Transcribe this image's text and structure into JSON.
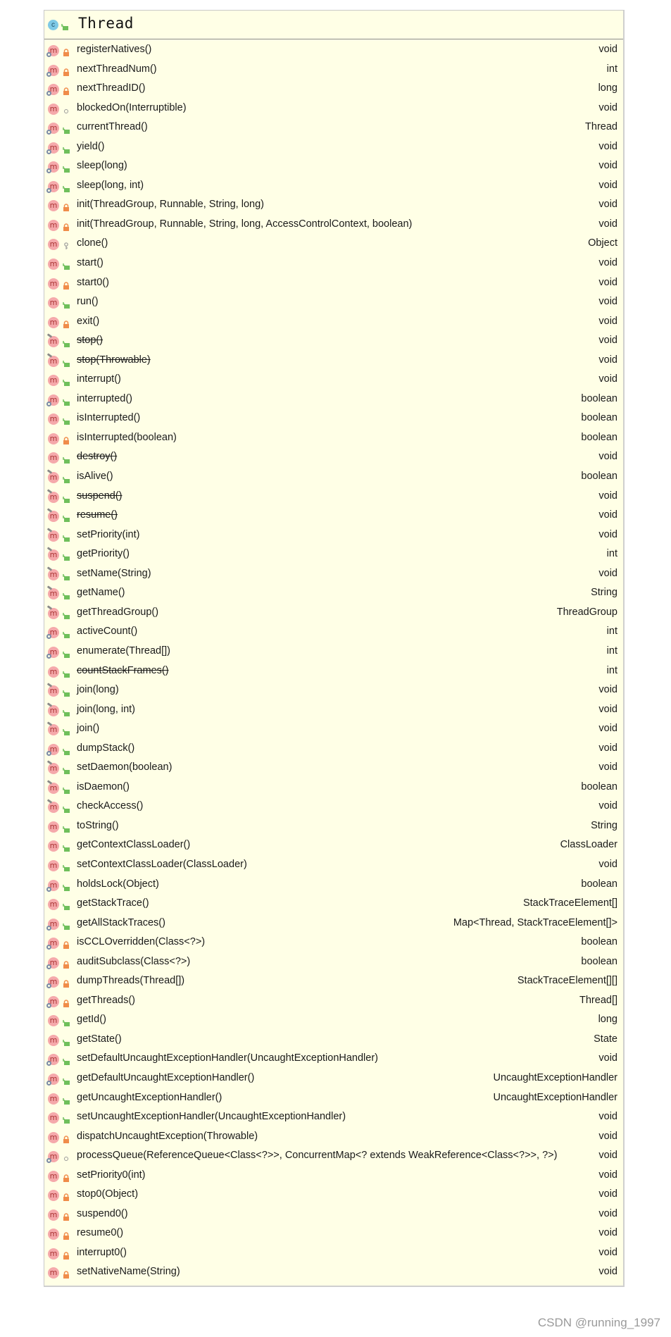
{
  "class": {
    "name": "Thread",
    "kind_icon": "class-icon",
    "visibility": "public"
  },
  "colors": {
    "background": "#ffffe6",
    "method_icon": "#f5a9ab",
    "class_icon": "#7ec9e6",
    "public": "#6fbf5b",
    "private": "#f08c4a"
  },
  "methods": [
    {
      "name": "registerNatives()",
      "type": "void",
      "vis": "private",
      "static": true,
      "final": false,
      "deprecated": false
    },
    {
      "name": "nextThreadNum()",
      "type": "int",
      "vis": "private",
      "static": true,
      "final": false,
      "deprecated": false
    },
    {
      "name": "nextThreadID()",
      "type": "long",
      "vis": "private",
      "static": true,
      "final": false,
      "deprecated": false
    },
    {
      "name": "blockedOn(Interruptible)",
      "type": "void",
      "vis": "package",
      "static": false,
      "final": false,
      "deprecated": false
    },
    {
      "name": "currentThread()",
      "type": "Thread",
      "vis": "public",
      "static": true,
      "final": false,
      "deprecated": false
    },
    {
      "name": "yield()",
      "type": "void",
      "vis": "public",
      "static": true,
      "final": false,
      "deprecated": false
    },
    {
      "name": "sleep(long)",
      "type": "void",
      "vis": "public",
      "static": true,
      "final": false,
      "deprecated": false
    },
    {
      "name": "sleep(long, int)",
      "type": "void",
      "vis": "public",
      "static": true,
      "final": false,
      "deprecated": false
    },
    {
      "name": "init(ThreadGroup, Runnable, String, long)",
      "type": "void",
      "vis": "private",
      "static": false,
      "final": false,
      "deprecated": false
    },
    {
      "name": "init(ThreadGroup, Runnable, String, long, AccessControlContext, boolean)",
      "type": "void",
      "vis": "private",
      "static": false,
      "final": false,
      "deprecated": false
    },
    {
      "name": "clone()",
      "type": "Object",
      "vis": "protected",
      "static": false,
      "final": false,
      "deprecated": false
    },
    {
      "name": "start()",
      "type": "void",
      "vis": "public",
      "static": false,
      "final": false,
      "deprecated": false
    },
    {
      "name": "start0()",
      "type": "void",
      "vis": "private",
      "static": false,
      "final": false,
      "deprecated": false
    },
    {
      "name": "run()",
      "type": "void",
      "vis": "public",
      "static": false,
      "final": false,
      "deprecated": false
    },
    {
      "name": "exit()",
      "type": "void",
      "vis": "private",
      "static": false,
      "final": false,
      "deprecated": false
    },
    {
      "name": "stop()",
      "type": "void",
      "vis": "public",
      "static": false,
      "final": true,
      "deprecated": true
    },
    {
      "name": "stop(Throwable)",
      "type": "void",
      "vis": "public",
      "static": false,
      "final": true,
      "deprecated": true
    },
    {
      "name": "interrupt()",
      "type": "void",
      "vis": "public",
      "static": false,
      "final": false,
      "deprecated": false
    },
    {
      "name": "interrupted()",
      "type": "boolean",
      "vis": "public",
      "static": true,
      "final": false,
      "deprecated": false
    },
    {
      "name": "isInterrupted()",
      "type": "boolean",
      "vis": "public",
      "static": false,
      "final": false,
      "deprecated": false
    },
    {
      "name": "isInterrupted(boolean)",
      "type": "boolean",
      "vis": "private",
      "static": false,
      "final": false,
      "deprecated": false
    },
    {
      "name": "destroy()",
      "type": "void",
      "vis": "public",
      "static": false,
      "final": false,
      "deprecated": true
    },
    {
      "name": "isAlive()",
      "type": "boolean",
      "vis": "public",
      "static": false,
      "final": true,
      "deprecated": false
    },
    {
      "name": "suspend()",
      "type": "void",
      "vis": "public",
      "static": false,
      "final": true,
      "deprecated": true
    },
    {
      "name": "resume()",
      "type": "void",
      "vis": "public",
      "static": false,
      "final": true,
      "deprecated": true
    },
    {
      "name": "setPriority(int)",
      "type": "void",
      "vis": "public",
      "static": false,
      "final": true,
      "deprecated": false
    },
    {
      "name": "getPriority()",
      "type": "int",
      "vis": "public",
      "static": false,
      "final": true,
      "deprecated": false
    },
    {
      "name": "setName(String)",
      "type": "void",
      "vis": "public",
      "static": false,
      "final": true,
      "deprecated": false
    },
    {
      "name": "getName()",
      "type": "String",
      "vis": "public",
      "static": false,
      "final": true,
      "deprecated": false
    },
    {
      "name": "getThreadGroup()",
      "type": "ThreadGroup",
      "vis": "public",
      "static": false,
      "final": true,
      "deprecated": false
    },
    {
      "name": "activeCount()",
      "type": "int",
      "vis": "public",
      "static": true,
      "final": false,
      "deprecated": false
    },
    {
      "name": "enumerate(Thread[])",
      "type": "int",
      "vis": "public",
      "static": true,
      "final": false,
      "deprecated": false
    },
    {
      "name": "countStackFrames()",
      "type": "int",
      "vis": "public",
      "static": false,
      "final": false,
      "deprecated": true
    },
    {
      "name": "join(long)",
      "type": "void",
      "vis": "public",
      "static": false,
      "final": true,
      "deprecated": false
    },
    {
      "name": "join(long, int)",
      "type": "void",
      "vis": "public",
      "static": false,
      "final": true,
      "deprecated": false
    },
    {
      "name": "join()",
      "type": "void",
      "vis": "public",
      "static": false,
      "final": true,
      "deprecated": false
    },
    {
      "name": "dumpStack()",
      "type": "void",
      "vis": "public",
      "static": true,
      "final": false,
      "deprecated": false
    },
    {
      "name": "setDaemon(boolean)",
      "type": "void",
      "vis": "public",
      "static": false,
      "final": true,
      "deprecated": false
    },
    {
      "name": "isDaemon()",
      "type": "boolean",
      "vis": "public",
      "static": false,
      "final": true,
      "deprecated": false
    },
    {
      "name": "checkAccess()",
      "type": "void",
      "vis": "public",
      "static": false,
      "final": true,
      "deprecated": false
    },
    {
      "name": "toString()",
      "type": "String",
      "vis": "public",
      "static": false,
      "final": false,
      "deprecated": false
    },
    {
      "name": "getContextClassLoader()",
      "type": "ClassLoader",
      "vis": "public",
      "static": false,
      "final": false,
      "deprecated": false
    },
    {
      "name": "setContextClassLoader(ClassLoader)",
      "type": "void",
      "vis": "public",
      "static": false,
      "final": false,
      "deprecated": false
    },
    {
      "name": "holdsLock(Object)",
      "type": "boolean",
      "vis": "public",
      "static": true,
      "final": false,
      "deprecated": false
    },
    {
      "name": "getStackTrace()",
      "type": "StackTraceElement[]",
      "vis": "public",
      "static": false,
      "final": false,
      "deprecated": false
    },
    {
      "name": "getAllStackTraces()",
      "type": "Map<Thread, StackTraceElement[]>",
      "vis": "public",
      "static": true,
      "final": false,
      "deprecated": false
    },
    {
      "name": "isCCLOverridden(Class<?>)",
      "type": "boolean",
      "vis": "private",
      "static": true,
      "final": false,
      "deprecated": false
    },
    {
      "name": "auditSubclass(Class<?>)",
      "type": "boolean",
      "vis": "private",
      "static": true,
      "final": false,
      "deprecated": false
    },
    {
      "name": "dumpThreads(Thread[])",
      "type": "StackTraceElement[][]",
      "vis": "private",
      "static": true,
      "final": false,
      "deprecated": false
    },
    {
      "name": "getThreads()",
      "type": "Thread[]",
      "vis": "private",
      "static": true,
      "final": false,
      "deprecated": false
    },
    {
      "name": "getId()",
      "type": "long",
      "vis": "public",
      "static": false,
      "final": false,
      "deprecated": false
    },
    {
      "name": "getState()",
      "type": "State",
      "vis": "public",
      "static": false,
      "final": false,
      "deprecated": false
    },
    {
      "name": "setDefaultUncaughtExceptionHandler(UncaughtExceptionHandler)",
      "type": "void",
      "vis": "public",
      "static": true,
      "final": false,
      "deprecated": false
    },
    {
      "name": "getDefaultUncaughtExceptionHandler()",
      "type": "UncaughtExceptionHandler",
      "vis": "public",
      "static": true,
      "final": false,
      "deprecated": false
    },
    {
      "name": "getUncaughtExceptionHandler()",
      "type": "UncaughtExceptionHandler",
      "vis": "public",
      "static": false,
      "final": false,
      "deprecated": false
    },
    {
      "name": "setUncaughtExceptionHandler(UncaughtExceptionHandler)",
      "type": "void",
      "vis": "public",
      "static": false,
      "final": false,
      "deprecated": false
    },
    {
      "name": "dispatchUncaughtException(Throwable)",
      "type": "void",
      "vis": "private",
      "static": false,
      "final": false,
      "deprecated": false
    },
    {
      "name": "processQueue(ReferenceQueue<Class<?>>, ConcurrentMap<? extends WeakReference<Class<?>>, ?>)",
      "type": "void",
      "vis": "package",
      "static": true,
      "final": false,
      "deprecated": false
    },
    {
      "name": "setPriority0(int)",
      "type": "void",
      "vis": "private",
      "static": false,
      "final": false,
      "deprecated": false
    },
    {
      "name": "stop0(Object)",
      "type": "void",
      "vis": "private",
      "static": false,
      "final": false,
      "deprecated": false
    },
    {
      "name": "suspend0()",
      "type": "void",
      "vis": "private",
      "static": false,
      "final": false,
      "deprecated": false
    },
    {
      "name": "resume0()",
      "type": "void",
      "vis": "private",
      "static": false,
      "final": false,
      "deprecated": false
    },
    {
      "name": "interrupt0()",
      "type": "void",
      "vis": "private",
      "static": false,
      "final": false,
      "deprecated": false
    },
    {
      "name": "setNativeName(String)",
      "type": "void",
      "vis": "private",
      "static": false,
      "final": false,
      "deprecated": false
    }
  ],
  "icons": {
    "class_letter": "c",
    "method_letter": "m"
  },
  "watermark": "CSDN @running_1997"
}
